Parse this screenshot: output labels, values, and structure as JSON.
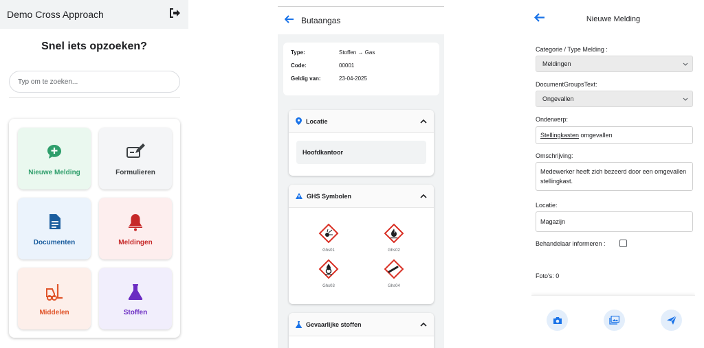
{
  "screen1": {
    "app_title": "Demo Cross Approach",
    "heading": "Snel iets opzoeken?",
    "search_placeholder": "Typ om te zoeken...",
    "tiles": [
      {
        "label": "Nieuwe Melding",
        "color": "#2e9e6b",
        "bg": "#eaf8ef"
      },
      {
        "label": "Formulieren",
        "color": "#3c4043",
        "bg": "#f4f5f7"
      },
      {
        "label": "Documenten",
        "color": "#1a5d9e",
        "bg": "#ebf3fc"
      },
      {
        "label": "Meldingen",
        "color": "#c62828",
        "bg": "#fdeeee"
      },
      {
        "label": "Middelen",
        "color": "#e0552b",
        "bg": "#fdefea"
      },
      {
        "label": "Stoffen",
        "color": "#6a2bc2",
        "bg": "#f1eefc"
      }
    ]
  },
  "screen2": {
    "title": "Butaangas",
    "info": [
      {
        "key": "Type:",
        "value": "Stoffen → Gas"
      },
      {
        "key": "Code:",
        "value": "00001"
      },
      {
        "key": "Geldig van:",
        "value": "23-04-2025"
      }
    ],
    "sections": {
      "locatie": {
        "title": "Locatie",
        "value": "Hoofdkantoor"
      },
      "ghs": {
        "title": "GHS Symbolen",
        "symbols": [
          "Ghs01",
          "Ghs02",
          "Ghs03",
          "Ghs04"
        ]
      },
      "stoffen": {
        "title": "Gevaarlijke stoffen"
      }
    },
    "accent": "#1a73e8",
    "ghs_red": "#d93025"
  },
  "screen3": {
    "title": "Nieuwe Melding",
    "categorie_label": "Categorie / Type Melding :",
    "categorie_value": "Meldingen",
    "docgroups_label": "DocumentGroupsText:",
    "docgroups_value": "Ongevallen",
    "onderwerp_label": "Onderwerp:",
    "onderwerp_value_underlined": "Stellingkasten",
    "onderwerp_value_rest": " omgevallen",
    "omschrijving_label": "Omschrijving:",
    "omschrijving_value": "Medewerker heeft zich bezeerd door een omgevallen stellingkast.",
    "locatie_label": "Locatie:",
    "locatie_value": "Magazijn",
    "behandelaar_label": "Behandelaar informeren :",
    "fotos_label": "Foto's: 0"
  }
}
